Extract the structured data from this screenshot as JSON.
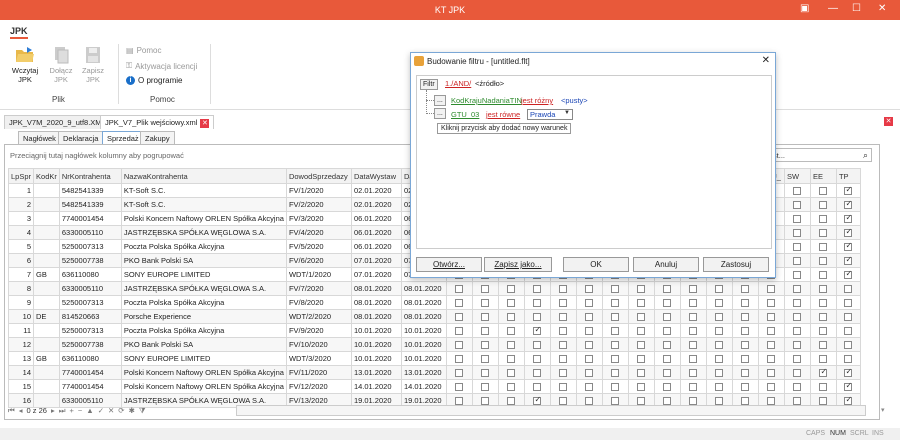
{
  "window": {
    "title": "KT JPK"
  },
  "app_tab": "JPK",
  "ribbon": {
    "load_label": "Wczytaj\nJPK",
    "attach_label": "Dołącz\nJPK",
    "save_label": "Zapisz\nJPK",
    "group_file": "Plik",
    "help": "Pomoc",
    "license": "Aktywacja licencji",
    "about": "O programie",
    "group_help": "Pomoc"
  },
  "doc_tabs": [
    {
      "label": "JPK_V7M_2020_9_utf8.XML"
    },
    {
      "label": "JPK_V7_Plik wejściowy.xml"
    }
  ],
  "sub_tabs": [
    "Nagłówek",
    "Deklaracja",
    "Sprzedaż",
    "Zakupy"
  ],
  "grid": {
    "group_hint": "Przeciągnij tutaj nagłówek kolumny aby pogrupować",
    "search_placeholder": "ekst...",
    "left_headers": [
      "LpSpr",
      "KodKr",
      "NrKontrahenta",
      "NazwaKontrahenta",
      "DowodSprzedazy",
      "DataWystaw",
      "DataSpr"
    ],
    "right_headers": [
      "GTU_",
      "SW",
      "EE",
      "TP"
    ],
    "rows": [
      [
        "1",
        "",
        "5482541339",
        "KT-Soft S.C.",
        "FV/1/2020",
        "02.01.2020",
        "02.01."
      ],
      [
        "2",
        "",
        "5482541339",
        "KT-Soft S.C.",
        "FV/2/2020",
        "02.01.2020",
        "02.01."
      ],
      [
        "3",
        "",
        "7740001454",
        "Polski Koncern Naftowy ORLEN Spółka Akcyjna",
        "FV/3/2020",
        "06.01.2020",
        "06.01."
      ],
      [
        "4",
        "",
        "6330005110",
        "JASTRZĘBSKA SPÓŁKA WĘGLOWA S.A.",
        "FV/4/2020",
        "06.01.2020",
        "06.01."
      ],
      [
        "5",
        "",
        "5250007313",
        "Poczta Polska Spółka Akcyjna",
        "FV/5/2020",
        "06.01.2020",
        "06.01."
      ],
      [
        "6",
        "",
        "5250007738",
        "PKO Bank Polski SA",
        "FV/6/2020",
        "07.01.2020",
        "07.01."
      ],
      [
        "7",
        "GB",
        "636110080",
        "SONY EUROPE LIMITED",
        "WDT/1/2020",
        "07.01.2020",
        "07.01."
      ],
      [
        "8",
        "",
        "6330005110",
        "JASTRZĘBSKA SPÓŁKA WĘGLOWA S.A.",
        "FV/7/2020",
        "08.01.2020",
        "08.01.2020"
      ],
      [
        "9",
        "",
        "5250007313",
        "Poczta Polska Spółka Akcyjna",
        "FV/8/2020",
        "08.01.2020",
        "08.01.2020"
      ],
      [
        "10",
        "DE",
        "814520663",
        "Porsche Experience",
        "WDT/2/2020",
        "08.01.2020",
        "08.01.2020"
      ],
      [
        "11",
        "",
        "5250007313",
        "Poczta Polska Spółka Akcyjna",
        "FV/9/2020",
        "10.01.2020",
        "10.01.2020"
      ],
      [
        "12",
        "",
        "5250007738",
        "PKO Bank Polski SA",
        "FV/10/2020",
        "10.01.2020",
        "10.01.2020"
      ],
      [
        "13",
        "GB",
        "636110080",
        "SONY EUROPE LIMITED",
        "WDT/3/2020",
        "10.01.2020",
        "10.01.2020"
      ],
      [
        "14",
        "",
        "7740001454",
        "Polski Koncern Naftowy ORLEN Spółka Akcyjna",
        "FV/11/2020",
        "13.01.2020",
        "13.01.2020"
      ],
      [
        "15",
        "",
        "7740001454",
        "Polski Koncern Naftowy ORLEN Spółka Akcyjna",
        "FV/12/2020",
        "14.01.2020",
        "14.01.2020"
      ],
      [
        "16",
        "",
        "6330005110",
        "JASTRZĘBSKA SPÓŁKA WĘGLOWA S.A.",
        "FV/13/2020",
        "19.01.2020",
        "19.01.2020"
      ]
    ],
    "tp_checked_rows": [
      1,
      2,
      3,
      4,
      5,
      6,
      7,
      14,
      15,
      16
    ],
    "gtu_checked_rows": [],
    "pager_text": "0 z 26"
  },
  "dialog": {
    "title": "Budowanie filtru - [untitled.flt]",
    "filter_btn": "Filtr",
    "and_op": "1./AND/",
    "source": "<źródło>",
    "cond1_field": "KodKrajuNadaniaTIN",
    "cond1_op": "jest różny",
    "cond1_value": "<pusty>",
    "cond2_field": "GTU_03",
    "cond2_op": "jest równe",
    "cond2_value": "Prawda",
    "tip": "Kliknij przycisk aby dodać nowy warunek",
    "ellipsis": "...",
    "btn_open": "Otwórz...",
    "btn_saveas": "Zapisz jako...",
    "btn_ok": "OK",
    "btn_cancel": "Anuluj",
    "btn_apply": "Zastosuj"
  },
  "statusbar": {
    "caps": "CAPS",
    "num": "NUM",
    "scrl": "SCRL",
    "ins": "INS"
  },
  "colors": {
    "accent": "#e8593a",
    "link_green": "#2e8b2e",
    "link_red": "#cc2222",
    "link_blue": "#1a45b5"
  }
}
